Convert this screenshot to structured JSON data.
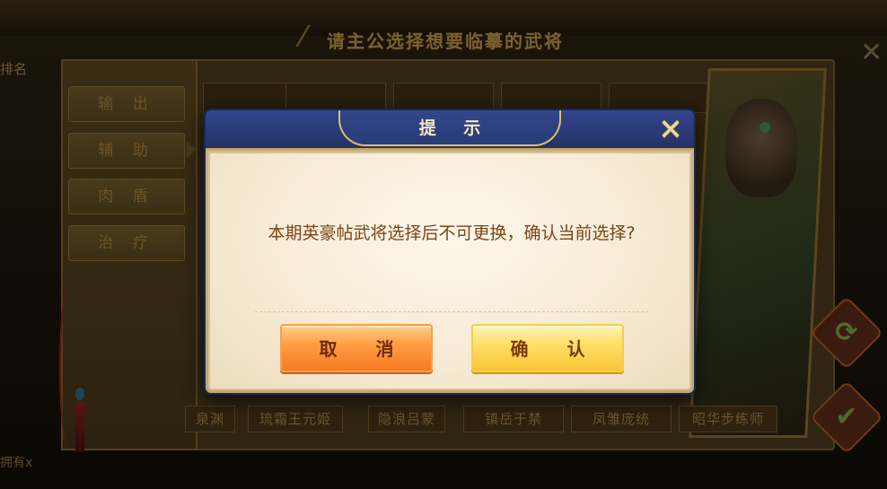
{
  "background": {
    "top_title": "请主公选择想要临摹的武将",
    "top_faded_left": "",
    "top_faded_center": "",
    "rank_label": "排名",
    "bottom_left_text": "拥有x",
    "categories": [
      "输 出",
      "辅 助",
      "肉 盾",
      "治 疗"
    ],
    "selected_category": "辅 助",
    "hero_names": [
      "泉渊",
      "琉霜王元姬",
      "隐浪吕蒙",
      "镇岳于禁",
      "凤雏庞统",
      "昭华步练师"
    ],
    "close_glyph": "✕",
    "refresh_glyph": "⟳",
    "check_glyph": "✔"
  },
  "dialog": {
    "title": "提 示",
    "close_glyph": "✕",
    "message": "本期英豪帖武将选择后不可更换，确认当前选择?",
    "cancel_label": "取 消",
    "confirm_label": "确 认"
  },
  "colors": {
    "header_blue": "#2a3a77",
    "gold_trim": "#e0bf6b",
    "message_brown": "#7a4518",
    "cancel_orange": "#ff9f45",
    "confirm_yellow": "#ffe06a"
  }
}
